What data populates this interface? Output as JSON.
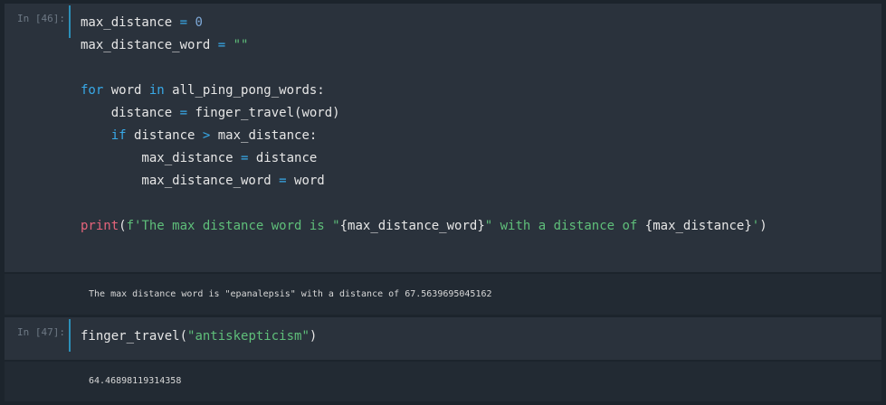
{
  "cells": [
    {
      "prompt": "In [46]:",
      "code_lines": [
        [
          [
            "max_distance ",
            "p"
          ],
          [
            "=",
            "op"
          ],
          [
            " ",
            "p"
          ],
          [
            "0",
            "num"
          ]
        ],
        [
          [
            "max_distance_word ",
            "p"
          ],
          [
            "=",
            "op"
          ],
          [
            " ",
            "p"
          ],
          [
            "\"\"",
            "str"
          ]
        ],
        [],
        [
          [
            "for",
            "kw"
          ],
          [
            " word ",
            "p"
          ],
          [
            "in",
            "kw"
          ],
          [
            " all_ping_pong_words:",
            "p"
          ]
        ],
        [
          [
            "    distance ",
            "p"
          ],
          [
            "=",
            "op"
          ],
          [
            " finger_travel(word)",
            "p"
          ]
        ],
        [
          [
            "    ",
            "p"
          ],
          [
            "if",
            "kw"
          ],
          [
            " distance ",
            "p"
          ],
          [
            ">",
            "op"
          ],
          [
            " max_distance:",
            "p"
          ]
        ],
        [
          [
            "        max_distance ",
            "p"
          ],
          [
            "=",
            "op"
          ],
          [
            " distance",
            "p"
          ]
        ],
        [
          [
            "        max_distance_word ",
            "p"
          ],
          [
            "=",
            "op"
          ],
          [
            " word",
            "p"
          ]
        ],
        [],
        [
          [
            "print",
            "bi"
          ],
          [
            "(",
            "p"
          ],
          [
            "f'The max distance word is \"",
            "str"
          ],
          [
            "{max_distance_word}",
            "p"
          ],
          [
            "\" with a distance of ",
            "str"
          ],
          [
            "{max_distance}",
            "p"
          ],
          [
            "'",
            "str"
          ],
          [
            ")",
            "p"
          ]
        ]
      ],
      "output": "The max distance word is \"epanalepsis\" with a distance of 67.5639695045162"
    },
    {
      "prompt": "In [47]:",
      "code_lines": [
        [
          [
            "finger_travel(",
            "p"
          ],
          [
            "\"antiskepticism\"",
            "str"
          ],
          [
            ")",
            "p"
          ]
        ]
      ],
      "output": "64.46898119314358"
    }
  ],
  "colors": {
    "page_bg": "#1c242c",
    "code_bg": "#2a323c",
    "output_bg": "#222a33",
    "keyword": "#38a9e8",
    "string": "#5fbf7a",
    "builtin": "#e5647b",
    "number": "#7ea9d8",
    "prompt_bar": "#2c8fb8"
  }
}
